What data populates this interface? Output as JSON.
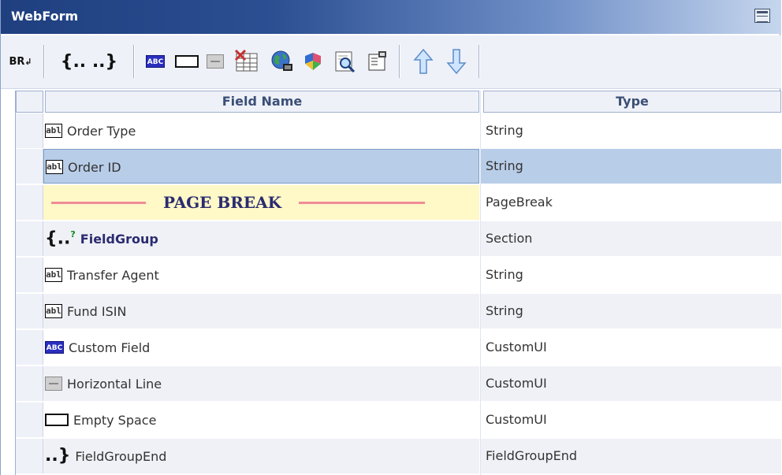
{
  "window": {
    "title": "WebForm"
  },
  "toolbar": {
    "br_label": "BR",
    "group_label": "{.. ..}",
    "abc_label": "ABC",
    "buttons": [
      "line-break-icon",
      "field-group-icon",
      "custom-field-icon",
      "empty-space-icon",
      "horizontal-line-icon",
      "delete-icon",
      "globe-icon",
      "puzzle-icon",
      "preview-icon",
      "properties-icon",
      "move-up-icon",
      "move-down-icon"
    ]
  },
  "grid": {
    "columns": [
      "Field Name",
      "Type"
    ],
    "rows": [
      {
        "name": "Order Type",
        "type": "String",
        "icon": "abl-icon"
      },
      {
        "name": "Order ID",
        "type": "String",
        "icon": "abl-icon",
        "selected": true
      },
      {
        "name": "PAGE BREAK",
        "type": "PageBreak",
        "icon": "page-break-icon"
      },
      {
        "name": "FieldGroup",
        "type": "Section",
        "icon": "field-group-icon"
      },
      {
        "name": "Transfer Agent",
        "type": "String",
        "icon": "abl-icon"
      },
      {
        "name": "Fund ISIN",
        "type": "String",
        "icon": "abl-icon"
      },
      {
        "name": "Custom Field",
        "type": "CustomUI",
        "icon": "abc-icon"
      },
      {
        "name": "Horizontal Line",
        "type": "CustomUI",
        "icon": "horizontal-line-icon"
      },
      {
        "name": "Empty Space",
        "type": "CustomUI",
        "icon": "empty-space-icon"
      },
      {
        "name": "FieldGroupEnd",
        "type": "FieldGroupEnd",
        "icon": "field-group-end-icon"
      }
    ]
  },
  "icons": {
    "abl_text": "abl",
    "abc_text": "ABC",
    "group_sup": "?"
  }
}
